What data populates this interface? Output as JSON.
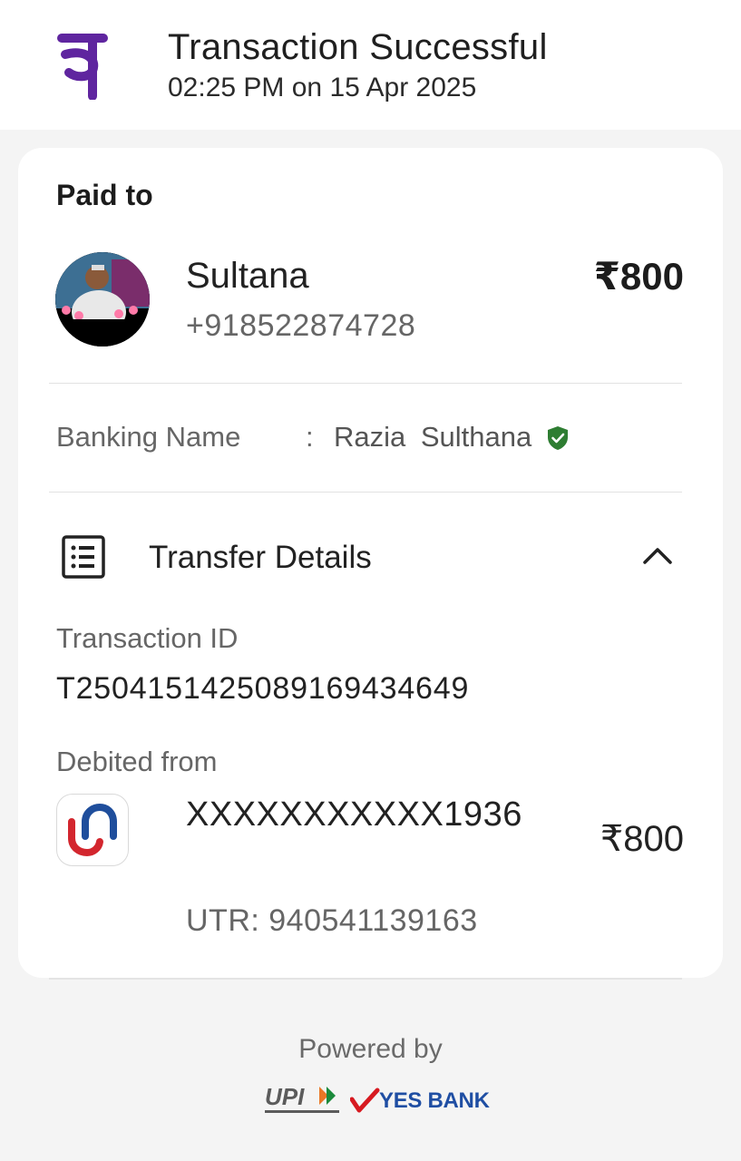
{
  "header": {
    "logo_icon": "phonepe-logo-icon",
    "title": "Transaction Successful",
    "timestamp": "02:25 PM on 15 Apr 2025",
    "brand_color": "#5f259f"
  },
  "paid_to": {
    "heading": "Paid to",
    "name": "Sultana",
    "phone": "+918522874728",
    "amount": "₹800"
  },
  "banking": {
    "label": "Banking Name",
    "colon": ":",
    "value": "Razia  Sulthana",
    "verified_icon": "verified-shield-icon",
    "verified_color": "#2e7d32"
  },
  "transfer_details": {
    "title": "Transfer Details",
    "icon": "receipt-list-icon",
    "toggle_icon": "chevron-up-icon",
    "transaction_id_label": "Transaction ID",
    "transaction_id": "T2504151425089169434649",
    "debited_from_label": "Debited from",
    "bank_logo_icon": "union-bank-logo-icon",
    "account_number": "XXXXXXXXXXX1936",
    "amount": "₹800",
    "utr": "UTR: 940541139163"
  },
  "footer": {
    "powered_by": "Powered by",
    "upi_logo": "upi-logo",
    "bank_logo": "yes-bank-logo",
    "bank_name": "YES BANK"
  }
}
